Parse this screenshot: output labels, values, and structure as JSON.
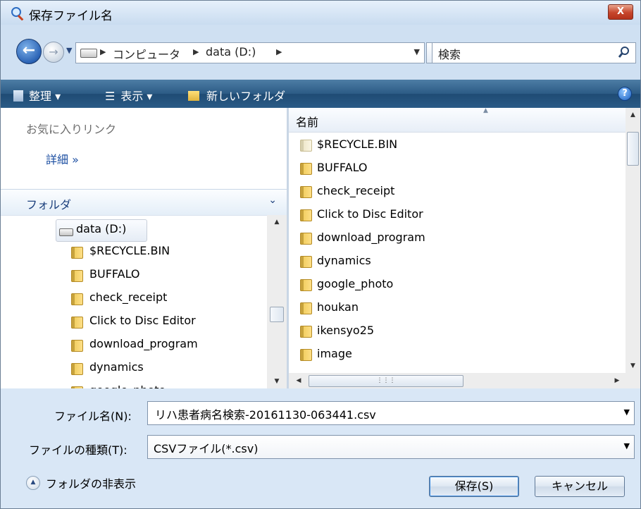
{
  "window": {
    "title": "保存ファイル名",
    "close_label": "X"
  },
  "address": {
    "breadcrumbs": [
      "コンピュータ",
      "data (D:)"
    ],
    "search_placeholder": "検索"
  },
  "toolbar": {
    "organize": "整理 ▾",
    "views": "表示 ▾",
    "new_folder": "新しいフォルダ",
    "help": "?"
  },
  "left": {
    "favorites_heading": "お気に入りリンク",
    "details_link": "詳細 »",
    "folders_heading": "フォルダ",
    "tree_root": "data (D:)",
    "tree_items": [
      "$RECYCLE.BIN",
      "BUFFALO",
      "check_receipt",
      "Click to Disc Editor",
      "download_program",
      "dynamics",
      "google_photo"
    ]
  },
  "right": {
    "column_header": "名前",
    "files": [
      "$RECYCLE.BIN",
      "BUFFALO",
      "check_receipt",
      "Click to Disc Editor",
      "download_program",
      "dynamics",
      "google_photo",
      "houkan",
      "ikensyo25",
      "image"
    ]
  },
  "bottom": {
    "filename_label": "ファイル名(N):",
    "filename_value": "リハ患者病名検索-20161130-063441.csv",
    "type_label": "ファイルの種類(T):",
    "type_value": "CSVファイル(*.csv)",
    "hide_folders": "フォルダの非表示",
    "save_button": "保存(S)",
    "cancel_button": "キャンセル"
  }
}
